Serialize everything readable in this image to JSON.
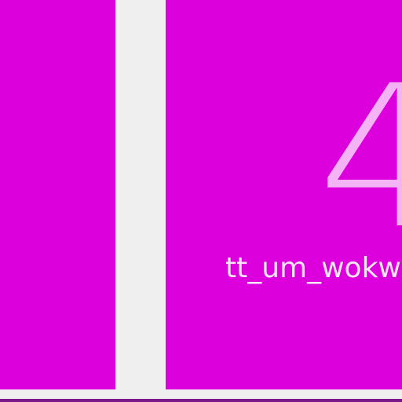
{
  "colors": {
    "tile_background": "#dc00dc",
    "page_background": "#efefef",
    "tile_number": "#f4b3f4",
    "tile_label": "#f6e6f6",
    "bottom_strip": "#7a1a8a"
  },
  "tiles": [
    {
      "number": "",
      "label": ""
    },
    {
      "number": "4",
      "label": "tt_um_wokwi"
    }
  ]
}
